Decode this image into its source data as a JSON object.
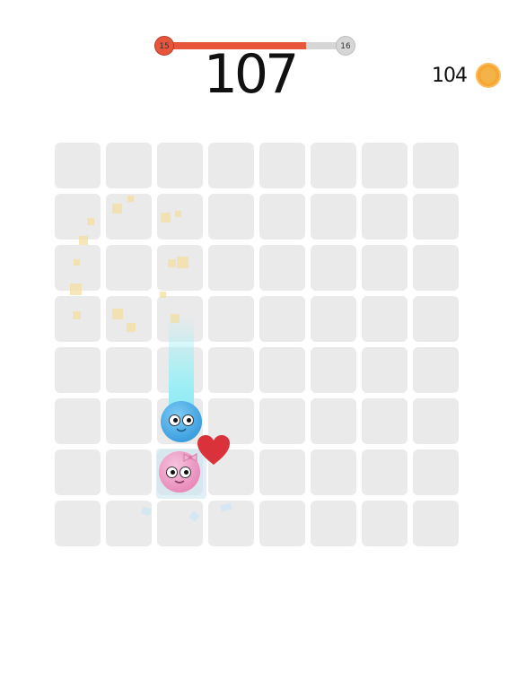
{
  "hud": {
    "level_current": "15",
    "level_next": "16",
    "level_progress": 0.78,
    "score": "107",
    "coins": "104",
    "coin_icon": "coin-icon"
  },
  "board": {
    "rows": 8,
    "cols": 8,
    "blue_ball": {
      "row": 5,
      "col": 2,
      "icon": "blue-ball-character"
    },
    "pink_ball": {
      "row": 6,
      "col": 2,
      "icon": "pink-ball-character"
    },
    "heart_icon": "heart-icon"
  },
  "colors": {
    "accent": "#e7563b",
    "cell": "#eaeaea",
    "coin": "#f4a836",
    "blue": "#3d9fe0",
    "pink": "#e98cbc",
    "heart": "#d9323b"
  }
}
